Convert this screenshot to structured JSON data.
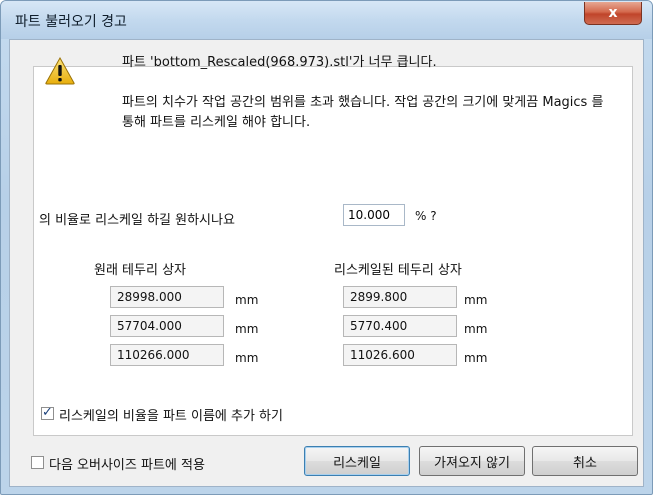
{
  "window": {
    "title": "파트 불러오기 경고",
    "close_label": "x"
  },
  "icons": {
    "warning": "warning-triangle-icon",
    "close": "close-icon"
  },
  "message": {
    "line1": "파트 'bottom_Rescaled(968.973).stl'가 너무 큽니다.",
    "line2": "파트의 치수가 작업 공간의 범위를 초과 했습니다. 작업 공간의 크기에 맞게끔 Magics 를 통해 파트를 리스케일 해야 합니다."
  },
  "scale": {
    "label": "의 비율로 리스케일 하길 원하시나요",
    "value": "10.000",
    "suffix": "% ?"
  },
  "original_box": {
    "title": "원래 테두리 상자",
    "values": [
      "28998.000",
      "57704.000",
      "110266.000"
    ],
    "unit": "mm"
  },
  "rescaled_box": {
    "title": "리스케일된 테두리 상자",
    "values": [
      "2899.800",
      "5770.400",
      "11026.600"
    ],
    "unit": "mm"
  },
  "options": {
    "add_ratio_to_name": {
      "label": "리스케일의 비율을 파트 이름에 추가 하기",
      "checked": true
    },
    "apply_to_next": {
      "label": "다음 오버사이즈 파트에 적용",
      "checked": false
    }
  },
  "buttons": {
    "rescale": "리스케일",
    "dont_import": "가져오지 않기",
    "cancel": "취소"
  },
  "colors": {
    "frame": "#b7d0e8",
    "close_button": "#c8513a",
    "warning_fill": "#f2c21b"
  }
}
